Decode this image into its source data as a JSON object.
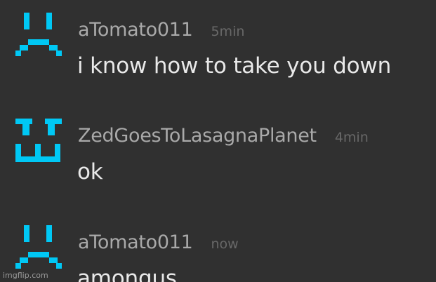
{
  "theme": {
    "background": "#303030",
    "avatar_color": "#00c8f5",
    "username_color": "#a9a9a9",
    "time_color": "#686868",
    "text_color": "#e9e9e9"
  },
  "messages": [
    {
      "username": "aTomato011",
      "time": "5min",
      "text": "i know how to take you down",
      "avatar_icon": "sad-face-icon"
    },
    {
      "username": "ZedGoesToLasagnaPlanet",
      "time": "4min",
      "text": "ok",
      "avatar_icon": "grin-face-icon"
    },
    {
      "username": "aTomato011",
      "time": "now",
      "text": "amongus",
      "avatar_icon": "sad-face-icon"
    }
  ],
  "watermark": "imgflip.com"
}
